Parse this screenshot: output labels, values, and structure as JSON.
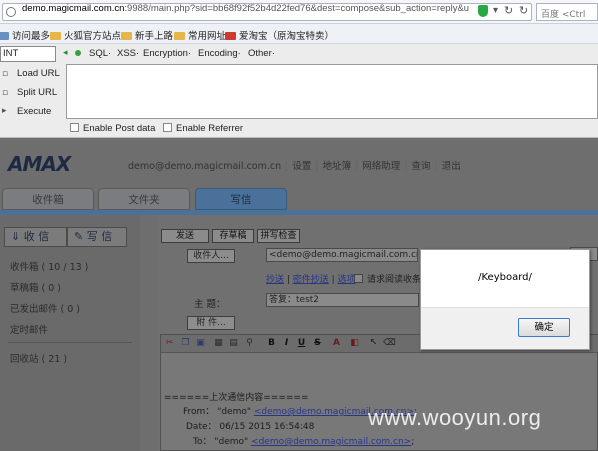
{
  "browser": {
    "url_host": "demo.magicmail.com.cn",
    "url_rest": ":9988/main.php?sid=bb68f92f52b4d22fed76&dest=compose&sub_action=reply&u",
    "search_placeholder": "百度 <Ctrl",
    "bookmarks": [
      "访问最多",
      "火狐官方站点",
      "新手上路",
      "常用网址",
      "爱淘宝（原淘宝特卖）"
    ]
  },
  "hackbar": {
    "select_value": "INT",
    "menus": [
      "SQL·",
      "XSS·",
      "Encryption·",
      "Encoding·",
      "Other·"
    ],
    "actions": [
      "Load URL",
      "Split URL",
      "Execute"
    ],
    "enable_post": "Enable Post data",
    "enable_referrer": "Enable Referrer"
  },
  "app": {
    "logo": "AMAX",
    "nav": [
      "demo@demo.magicmail.com.cn",
      "设置",
      "地址簿",
      "网络助理",
      "查询",
      "退出"
    ],
    "tabs": [
      "收件箱",
      "文件夹",
      "写信"
    ],
    "side_buttons": [
      "收 信",
      "写 信"
    ],
    "folders": [
      "收件箱 ( 10 / 13 )",
      "草稿箱 ( 0 )",
      "已发出邮件 ( 0 )",
      "定时邮件",
      "回收站 ( 21 )"
    ]
  },
  "compose": {
    "toolbar": [
      "发送",
      "存草稿",
      "拼写检查"
    ],
    "to_label": "收件人...",
    "to_value": "<demo@demo.magicmail.com.cn>",
    "cc_links": [
      "抄送",
      "密件抄送",
      "选项"
    ],
    "read_receipt": "请求阅读收条",
    "subject_label": "主 题：",
    "subject_value": "答复：test2",
    "attach_label": "附 件...",
    "quote_header": "======上次通信内容======",
    "from_label": "From：",
    "from_name": "\"demo\"",
    "from_email": "<demo@demo.magicmail.com.cn>",
    "date_label": "Date：",
    "date_value": "06/15 2015 16:54:48",
    "to_q_label": "To：",
    "to_q_name": "\"demo\"",
    "to_q_email": "<demo@demo.magicmail.com.cn>"
  },
  "dialog": {
    "message": "/Keyboard/",
    "ok": "确定"
  },
  "watermark": "www.wooyun.org"
}
